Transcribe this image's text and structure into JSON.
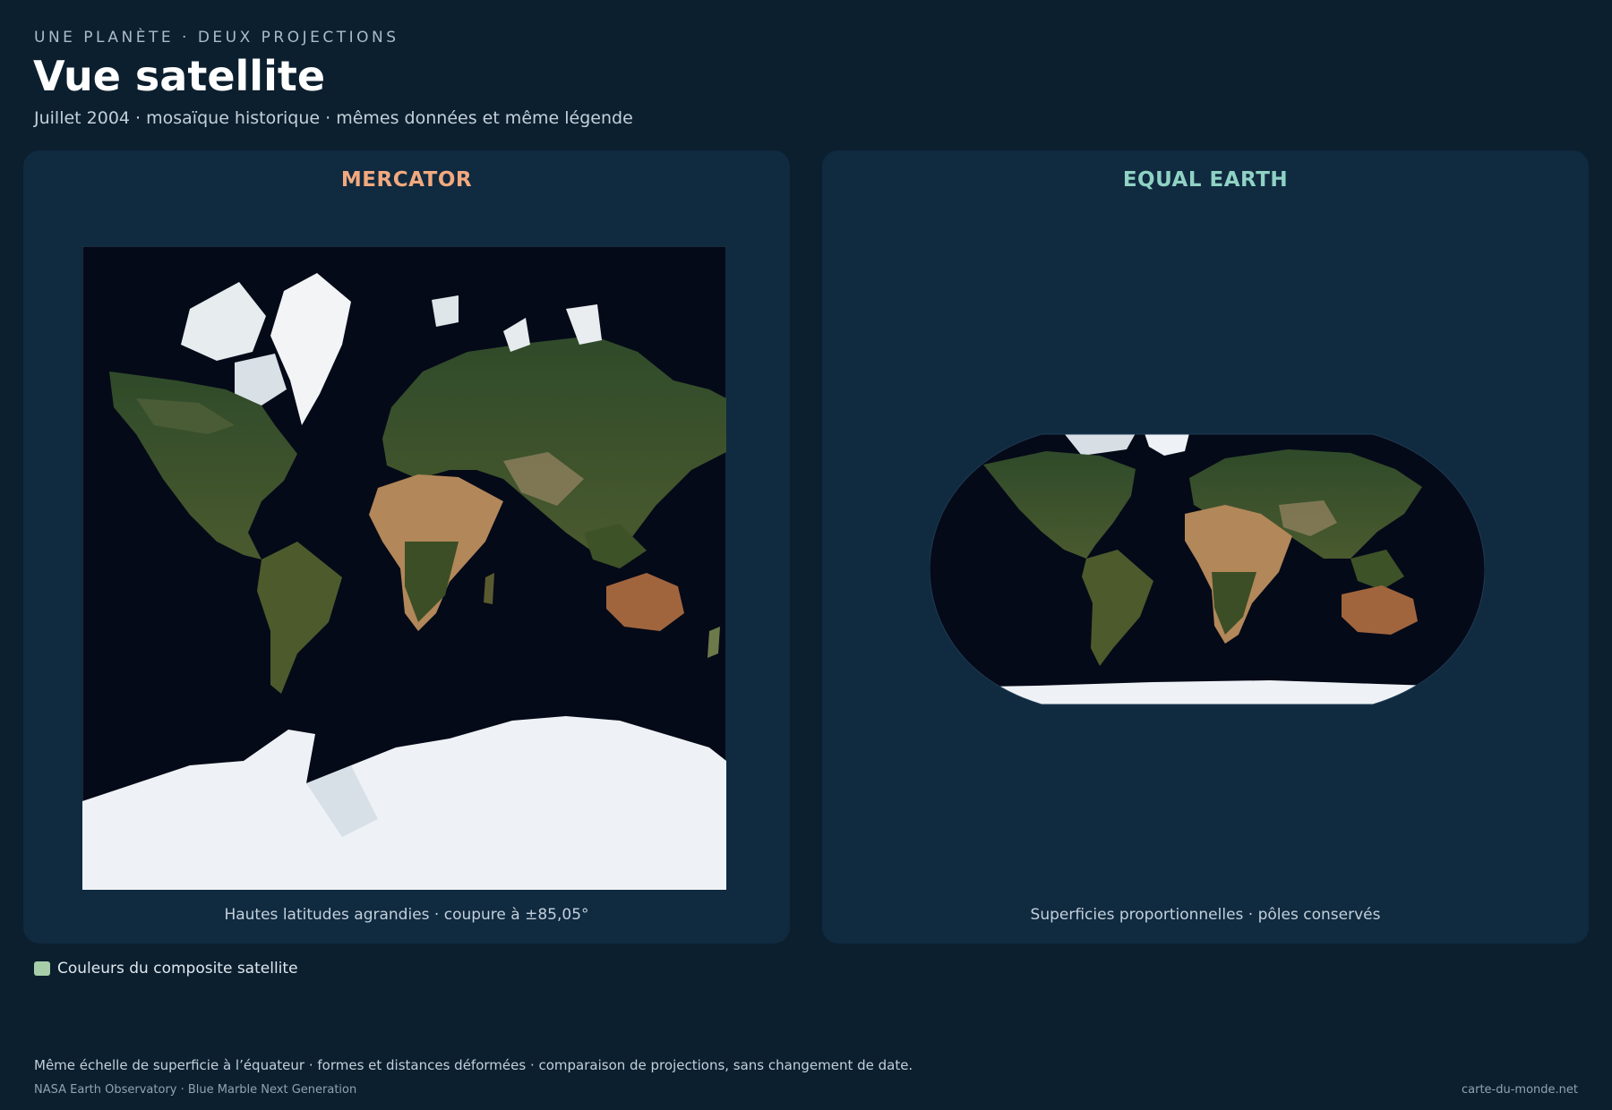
{
  "header": {
    "kicker": "UNE PLANÈTE · DEUX PROJECTIONS",
    "title": "Vue satellite",
    "subtitle": "Juillet 2004 · mosaïque historique · mêmes données et même légende"
  },
  "panels": {
    "left": {
      "title": "MERCATOR",
      "caption": "Hautes latitudes agrandies · coupure à ±85,05°"
    },
    "right": {
      "title": "EQUAL EARTH",
      "caption": "Superficies proportionnelles · pôles conservés"
    }
  },
  "legend": {
    "label": "Couleurs du composite satellite",
    "swatch_color": "#a6cfa9"
  },
  "footer": {
    "note": "Même échelle de superficie à l’équateur · formes et distances déformées · comparaison de projections, sans changement de date.",
    "source": "NASA Earth Observatory · Blue Marble Next Generation",
    "site": "carte-du-monde.net"
  },
  "colors": {
    "background": "#0c1f2e",
    "panel": "#102a40",
    "mercator_accent": "#f2a97e",
    "equal_earth_accent": "#8fd2c4",
    "ocean": "#050a18",
    "ice": "#eef2f6",
    "vegetation": "#3c5428",
    "desert": "#b2875a"
  }
}
